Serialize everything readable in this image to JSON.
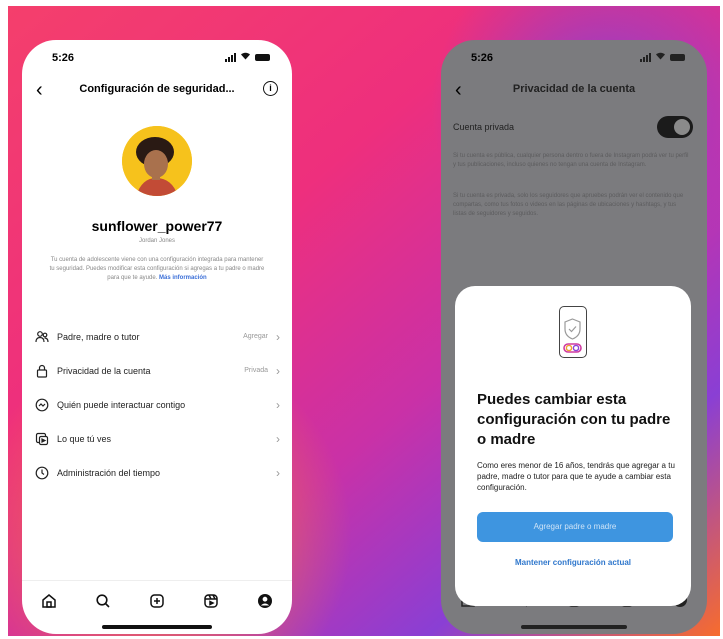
{
  "left": {
    "time": "5:26",
    "nav_title": "Configuración de seguridad...",
    "username": "sunflower_power77",
    "full_name": "Jordan Jones",
    "description": "Tu cuenta de adolescente viene con una configuración integrada para mantener tu seguridad. Puedes modificar esta configuración si agregas a tu padre o madre para que te ayude.",
    "description_link": "Más información",
    "menu": [
      {
        "label": "Padre, madre o tutor",
        "value": "Agregar",
        "icon": "people-icon"
      },
      {
        "label": "Privacidad de la cuenta",
        "value": "Privada",
        "icon": "lock-icon"
      },
      {
        "label": "Quién puede interactuar contigo",
        "value": "",
        "icon": "chat-icon"
      },
      {
        "label": "Lo que tú ves",
        "value": "",
        "icon": "content-icon"
      },
      {
        "label": "Administración del tiempo",
        "value": "",
        "icon": "clock-icon"
      }
    ]
  },
  "right": {
    "time": "5:26",
    "nav_title": "Privacidad de la cuenta",
    "toggle_label": "Cuenta privada",
    "toggle_on": true,
    "text_public": "Si tu cuenta es pública, cualquier persona dentro o fuera de Instagram podrá ver tu perfil y tus publicaciones, incluso quienes no tengan una cuenta de Instagram.",
    "text_private": "Si tu cuenta es privada, solo los seguidores que apruebes podrán ver el contenido que compartas, como tus fotos o videos en las páginas de ubicaciones y hashtags, y tus listas de seguidores y seguidos.",
    "sheet_title": "Puedes cambiar esta configuración con tu padre o madre",
    "sheet_body": "Como eres menor de 16 años, tendrás que agregar a tu padre, madre o tutor para que te ayude a cambiar esta configuración.",
    "sheet_button": "Agregar padre o madre",
    "sheet_link": "Mantener configuración actual"
  },
  "colors": {
    "accent_blue": "#3e95e0",
    "link_blue": "#2f77cc",
    "avatar_yellow": "#f6c21c"
  }
}
